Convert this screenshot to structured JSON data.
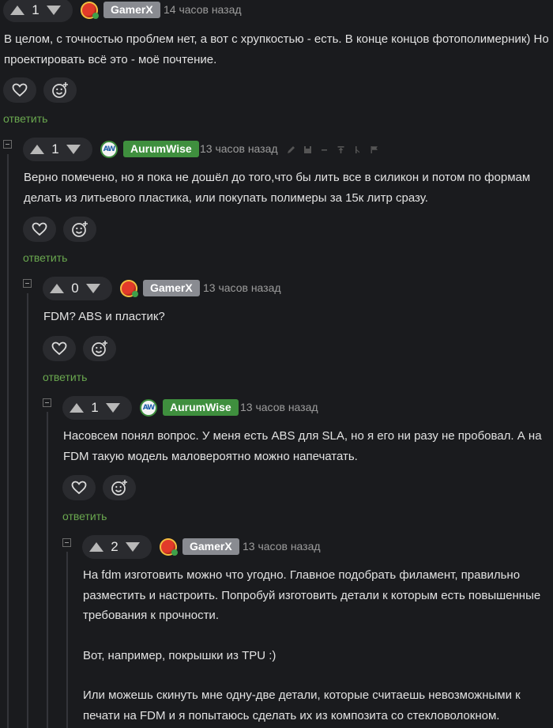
{
  "reply_label": "ответить",
  "comments": [
    {
      "score": "1",
      "user": "GamerX",
      "time": "14 часов назад",
      "paragraphs": [
        "В целом, с точностью проблем нет, а вот с хрупкостью - есть. В конце концов фотополимерник) Но проектировать всё это - моё почтение."
      ]
    },
    {
      "score": "1",
      "user": "AurumWise",
      "time": "13 часов назад",
      "paragraphs": [
        "Верно помечено, но я пока не дошёл до того,что бы лить все в силикон и потом по формам делать из литьевого пластика, или покупать полимеры за 15к литр сразу."
      ]
    },
    {
      "score": "0",
      "user": "GamerX",
      "time": "13 часов назад",
      "paragraphs": [
        "FDM? ABS и пластик?"
      ]
    },
    {
      "score": "1",
      "user": "AurumWise",
      "time": "13 часов назад",
      "paragraphs": [
        "Насовсем понял вопрос. У меня есть ABS для SLA, но я его ни разу не пробовал. А на FDM такую модель маловероятно можно напечатать."
      ]
    },
    {
      "score": "2",
      "user": "GamerX",
      "time": "13 часов назад",
      "paragraphs": [
        "На fdm изготовить можно что угодно. Главное подобрать филамент, правильно разместить и настроить. Попробуй изготовить детали к которым есть повышенные требования к прочности.",
        "Вот, например, покрышки из TPU :)",
        "Или можешь скинуть мне одну-две детали, которые считаешь невозможными к печати на FDM и я попытаюсь сделать их из композита со стекловолокном."
      ]
    }
  ],
  "colors": {
    "accent": "#6aa84f",
    "badge_gamer": "#898b91",
    "badge_aurum": "#3f8f3e",
    "background": "#1a1b1e"
  },
  "icons": [
    "heart-icon",
    "smiley-plus-icon",
    "pencil-icon",
    "save-icon",
    "dash-icon",
    "pin-icon",
    "branch-icon",
    "flag-icon"
  ]
}
